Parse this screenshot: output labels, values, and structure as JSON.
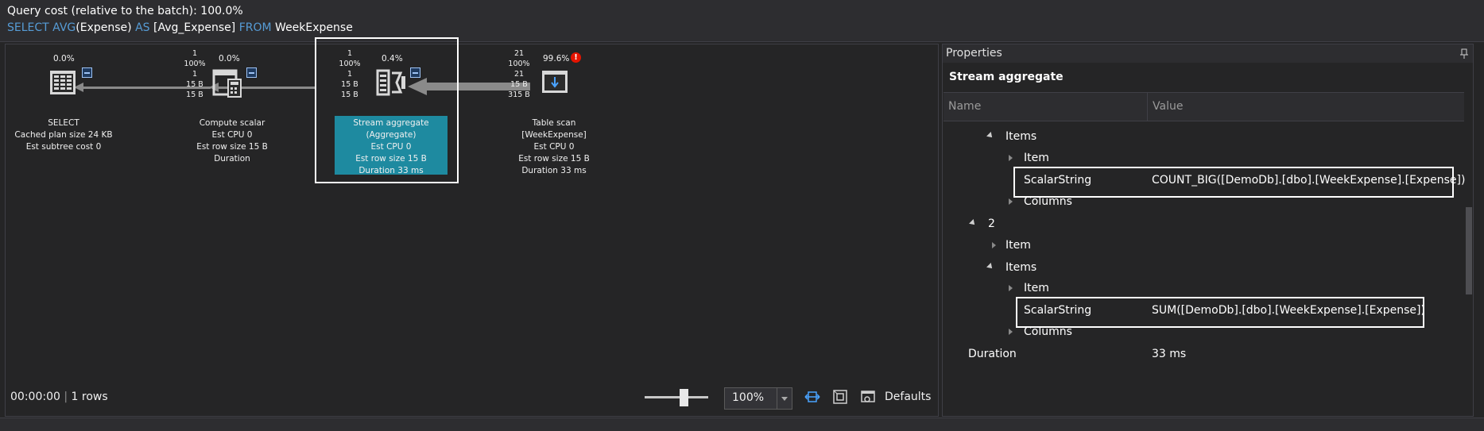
{
  "header": {
    "query_cost": "Query cost (relative to the batch):  100.0%",
    "sql": {
      "kw1": "SELECT AVG",
      "t1": "(Expense) ",
      "kw2": "AS",
      "t2": " [Avg_Expense] ",
      "kw3": "FROM",
      "t3": " WeekExpense"
    }
  },
  "plan": {
    "select": {
      "pct": "0.0%",
      "name": "SELECT",
      "l1": "Cached plan size  24 KB",
      "l2": "Est subtree cost  0",
      "icon": "select-grid-icon"
    },
    "compute": {
      "pct": "0.0%",
      "stats": [
        "1",
        "100%",
        "1",
        "15 B",
        "15 B"
      ],
      "name": "Compute scalar",
      "l1": "Est CPU  0",
      "l2": "Est row size  15 B",
      "l3": "Duration",
      "icon": "compute-scalar-icon"
    },
    "stream": {
      "pct": "0.4%",
      "stats": [
        "1",
        "100%",
        "1",
        "15 B",
        "15 B"
      ],
      "name": "Stream aggregate",
      "l0": "(Aggregate)",
      "l1": "Est CPU  0",
      "l2": "Est row size  15 B",
      "l3": "Duration  33 ms",
      "icon": "stream-aggregate-icon"
    },
    "scan": {
      "pct": "99.6%",
      "stats": [
        "21",
        "100%",
        "21",
        "15 B",
        "315 B"
      ],
      "name": "Table scan",
      "l0": "[WeekExpense]",
      "l1": "Est CPU  0",
      "l2": "Est row size  15 B",
      "l3": "Duration  33 ms",
      "icon": "table-scan-icon",
      "warning": "!"
    }
  },
  "status": {
    "time": "00:00:00",
    "rows": "1 rows",
    "zoom": "100%",
    "defaults": "Defaults",
    "sep": "|"
  },
  "properties": {
    "title": "Properties",
    "subtitle": "Stream aggregate",
    "col_name": "Name",
    "col_value": "Value",
    "rows": {
      "items1": "Items",
      "item1": "Item",
      "scalar1_name": "ScalarString",
      "scalar1_value": "COUNT_BIG([DemoDb].[dbo].[WeekExpense].[Expense])",
      "columns1": "Columns",
      "two": "2",
      "item2": "Item",
      "items2": "Items",
      "item3": "Item",
      "scalar2_name": "ScalarString",
      "scalar2_value": "SUM([DemoDb].[dbo].[WeekExpense].[Expense])",
      "columns2": "Columns",
      "duration_name": "Duration",
      "duration_value": "33 ms"
    }
  },
  "colors": {
    "accent": "#1e8aa0",
    "keyword": "#569cd6",
    "warning": "#e51400"
  }
}
